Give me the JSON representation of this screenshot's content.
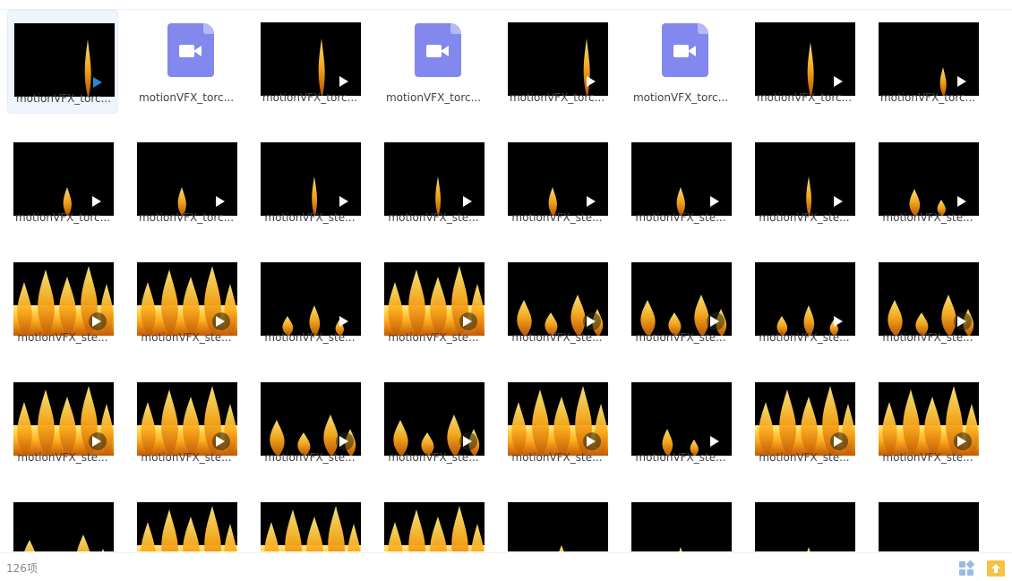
{
  "status_bar": {
    "item_count": "126项"
  },
  "icons": {
    "grid_view": "grid-view-icon",
    "upload": "upload-folder-icon",
    "video_file": "video-file-icon",
    "play": "play-icon"
  },
  "colors": {
    "accent": "#1e88e5",
    "video_file_icon": "#8288ee",
    "upload_icon": "#f5c242"
  },
  "files": [
    {
      "name": "motionVFX_torc...",
      "thumb": "torch-1",
      "kind": "video",
      "selected": true
    },
    {
      "name": "motionVFX_torc...",
      "thumb": "",
      "kind": "file-icon"
    },
    {
      "name": "motionVFX_torc...",
      "thumb": "torch-2",
      "kind": "video"
    },
    {
      "name": "motionVFX_torc...",
      "thumb": "",
      "kind": "file-icon"
    },
    {
      "name": "motionVFX_torc...",
      "thumb": "torch-3",
      "kind": "video"
    },
    {
      "name": "motionVFX_torc...",
      "thumb": "",
      "kind": "file-icon"
    },
    {
      "name": "motionVFX_torc...",
      "thumb": "torch-4",
      "kind": "video"
    },
    {
      "name": "motionVFX_torc...",
      "thumb": "torch-5",
      "kind": "video"
    },
    {
      "name": "motionVFX_torc...",
      "thumb": "small-flame",
      "kind": "video"
    },
    {
      "name": "motionVFX_torc...",
      "thumb": "small-flame",
      "kind": "video"
    },
    {
      "name": "motionVFX_ste...",
      "thumb": "thin-flame",
      "kind": "video"
    },
    {
      "name": "motionVFX_ste...",
      "thumb": "thin-flame",
      "kind": "video"
    },
    {
      "name": "motionVFX_ste...",
      "thumb": "small-flame",
      "kind": "video"
    },
    {
      "name": "motionVFX_ste...",
      "thumb": "small-flame",
      "kind": "video"
    },
    {
      "name": "motionVFX_ste...",
      "thumb": "thin-flame",
      "kind": "video"
    },
    {
      "name": "motionVFX_ste...",
      "thumb": "wave-flame",
      "kind": "video"
    },
    {
      "name": "motionVFX_ste...",
      "thumb": "big-fire",
      "kind": "video"
    },
    {
      "name": "motionVFX_ste...",
      "thumb": "big-fire",
      "kind": "video"
    },
    {
      "name": "motionVFX_ste...",
      "thumb": "low-fire",
      "kind": "video"
    },
    {
      "name": "motionVFX_ste...",
      "thumb": "big-fire",
      "kind": "video"
    },
    {
      "name": "motionVFX_ste...",
      "thumb": "mid-fire",
      "kind": "video"
    },
    {
      "name": "motionVFX_ste...",
      "thumb": "mid-fire",
      "kind": "video"
    },
    {
      "name": "motionVFX_ste...",
      "thumb": "low-fire",
      "kind": "video"
    },
    {
      "name": "motionVFX_ste...",
      "thumb": "mid-fire",
      "kind": "video"
    },
    {
      "name": "motionVFX_ste...",
      "thumb": "big-fire",
      "kind": "video"
    },
    {
      "name": "motionVFX_ste...",
      "thumb": "big-fire",
      "kind": "video"
    },
    {
      "name": "motionVFX_ste...",
      "thumb": "mid-fire",
      "kind": "video"
    },
    {
      "name": "motionVFX_ste...",
      "thumb": "mid-fire",
      "kind": "video"
    },
    {
      "name": "motionVFX_ste...",
      "thumb": "big-fire",
      "kind": "video"
    },
    {
      "name": "motionVFX_ste...",
      "thumb": "wave-flame",
      "kind": "video"
    },
    {
      "name": "motionVFX_ste...",
      "thumb": "big-fire",
      "kind": "video"
    },
    {
      "name": "motionVFX_ste...",
      "thumb": "big-fire",
      "kind": "video"
    },
    {
      "name": "",
      "thumb": "mid-fire",
      "kind": "video"
    },
    {
      "name": "",
      "thumb": "big-fire",
      "kind": "video"
    },
    {
      "name": "",
      "thumb": "big-fire",
      "kind": "video"
    },
    {
      "name": "",
      "thumb": "big-fire",
      "kind": "video"
    },
    {
      "name": "",
      "thumb": "low-fire",
      "kind": "video"
    },
    {
      "name": "",
      "thumb": "small-flame",
      "kind": "video"
    },
    {
      "name": "",
      "thumb": "small-flame",
      "kind": "video"
    },
    {
      "name": "",
      "thumb": "",
      "kind": "video"
    }
  ]
}
